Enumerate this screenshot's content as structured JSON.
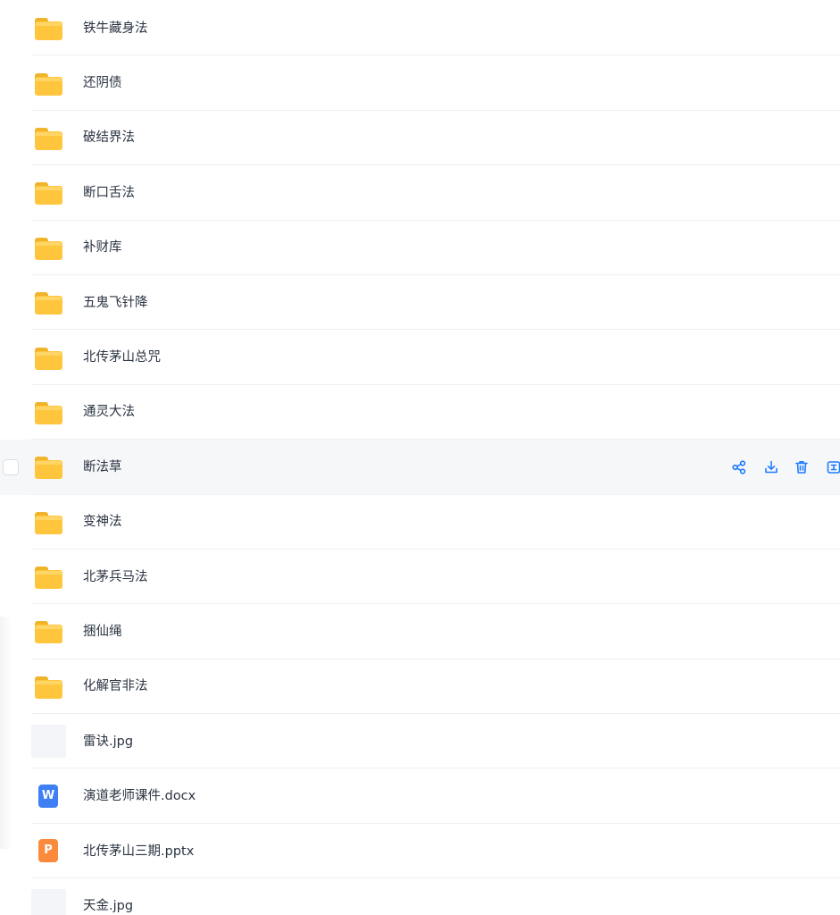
{
  "colors": {
    "accent": "#1f7cff",
    "folder": "#ffc53d",
    "text": "#2b3442",
    "divider": "#eef0f3",
    "hover_row": "#f6f7f9",
    "word": "#3f7ff4",
    "ppt": "#fb8a3c"
  },
  "files": [
    {
      "name": "铁牛藏身法",
      "type": "folder",
      "icon": "folder-icon"
    },
    {
      "name": "还阴债",
      "type": "folder",
      "icon": "folder-icon"
    },
    {
      "name": "破结界法",
      "type": "folder",
      "icon": "folder-icon"
    },
    {
      "name": "断口舌法",
      "type": "folder",
      "icon": "folder-icon"
    },
    {
      "name": "补财库",
      "type": "folder",
      "icon": "folder-icon"
    },
    {
      "name": "五鬼飞针降",
      "type": "folder",
      "icon": "folder-icon"
    },
    {
      "name": "北传茅山总咒",
      "type": "folder",
      "icon": "folder-icon"
    },
    {
      "name": "通灵大法",
      "type": "folder",
      "icon": "folder-icon"
    },
    {
      "name": "断法草",
      "type": "folder",
      "icon": "folder-icon",
      "hovered": true
    },
    {
      "name": "变神法",
      "type": "folder",
      "icon": "folder-icon"
    },
    {
      "name": "北茅兵马法",
      "type": "folder",
      "icon": "folder-icon"
    },
    {
      "name": "捆仙绳",
      "type": "folder",
      "icon": "folder-icon"
    },
    {
      "name": "化解官非法",
      "type": "folder",
      "icon": "folder-icon"
    },
    {
      "name": "雷诀.jpg",
      "type": "image",
      "icon": "image-thumbnail"
    },
    {
      "name": "演道老师课件.docx",
      "type": "word",
      "icon": "word-doc-icon",
      "badge": "W"
    },
    {
      "name": "北传茅山三期.pptx",
      "type": "ppt",
      "icon": "ppt-doc-icon",
      "badge": "P"
    },
    {
      "name": "天金.jpg",
      "type": "image",
      "icon": "image-thumbnail"
    }
  ],
  "row_actions": [
    {
      "name": "share",
      "icon": "share-icon"
    },
    {
      "name": "download",
      "icon": "download-icon"
    },
    {
      "name": "delete",
      "icon": "trash-icon"
    },
    {
      "name": "rename",
      "icon": "rename-icon"
    }
  ]
}
